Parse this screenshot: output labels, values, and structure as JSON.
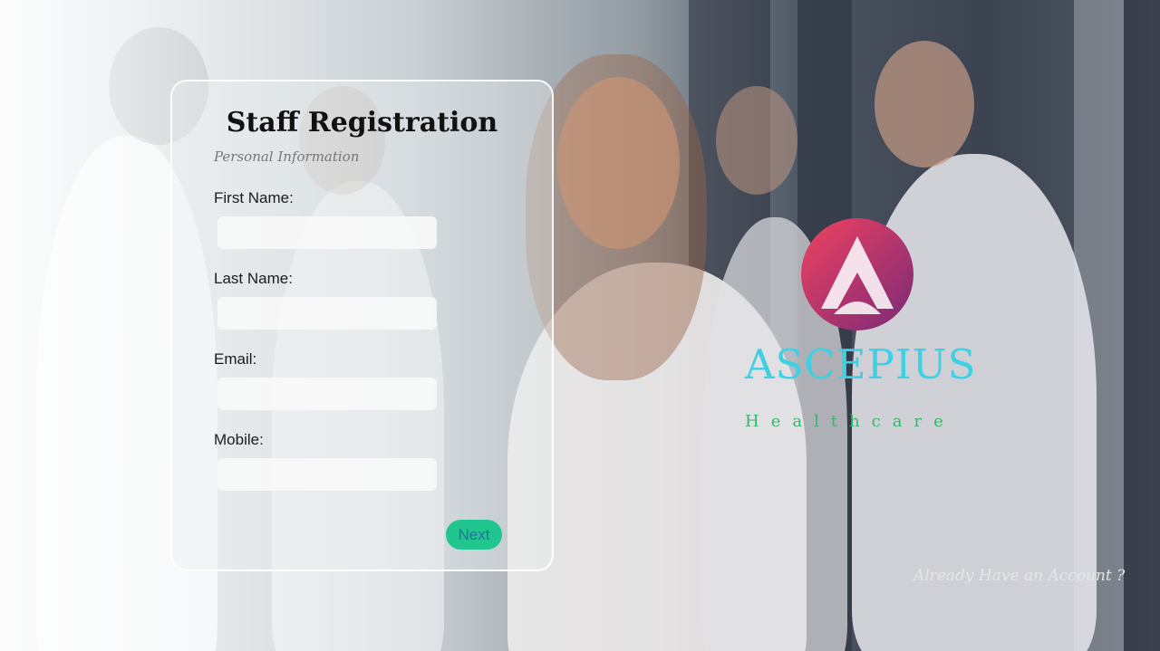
{
  "form": {
    "title": "Staff Registration",
    "subtitle": "Personal Information",
    "fields": [
      {
        "label": "First Name:",
        "value": ""
      },
      {
        "label": "Last Name:",
        "value": ""
      },
      {
        "label": "Email:",
        "value": ""
      },
      {
        "label": "Mobile:",
        "value": ""
      }
    ],
    "next_label": "Next"
  },
  "brand": {
    "name": "ASCEPIUS",
    "tagline": "Healthcare",
    "logo_icon": "ascepius-logo-icon"
  },
  "account_link": "Already Have an Account ?",
  "colors": {
    "button": "#21c58e",
    "button_text": "#2a6fa0",
    "brand_name": "#3fd0e4",
    "tagline": "#35b86a",
    "logo_gradient_start": "#f0425f",
    "logo_gradient_end": "#7a2a78"
  }
}
